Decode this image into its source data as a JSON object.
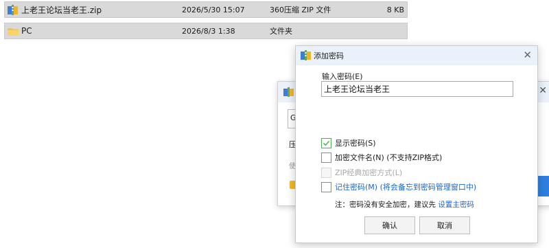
{
  "files": [
    {
      "name": "上老王论坛当老王.zip",
      "date": "2026/5/30 15:07",
      "type": "360压缩 ZIP 文件",
      "size": "8 KB",
      "icon": "zip-archive-icon"
    },
    {
      "name": "PC",
      "date": "2026/8/3 1:38",
      "type": "文件夹",
      "size": "",
      "icon": "folder-icon"
    }
  ],
  "background_dialog": {
    "partial_texts": [
      "G",
      "压",
      "使"
    ]
  },
  "dialog": {
    "title": "添加密码",
    "password_label": "输入密码(E)",
    "password_value": "上老王论坛当老王",
    "options": {
      "show_password": {
        "label": "显示密码(S)",
        "checked": true
      },
      "encrypt_filenames": {
        "label": "加密文件名(N) (不支持ZIP格式)",
        "checked": false
      },
      "zip_classic": {
        "label": "ZIP经典加密方式(L)",
        "checked": false,
        "disabled": true
      },
      "remember_password": {
        "label": "记住密码(M) (将会备忘到密码管理窗口中)",
        "checked": false
      }
    },
    "note_prefix": "注：密码没有安全加密，建议先 ",
    "note_link": "设置主密码",
    "ok_label": "确认",
    "cancel_label": "取消"
  },
  "colors": {
    "titlebar": "#eaf1fb",
    "link_blue": "#1a64c8",
    "check_green": "#4caf50",
    "row_selected": "#d9d9d9"
  }
}
